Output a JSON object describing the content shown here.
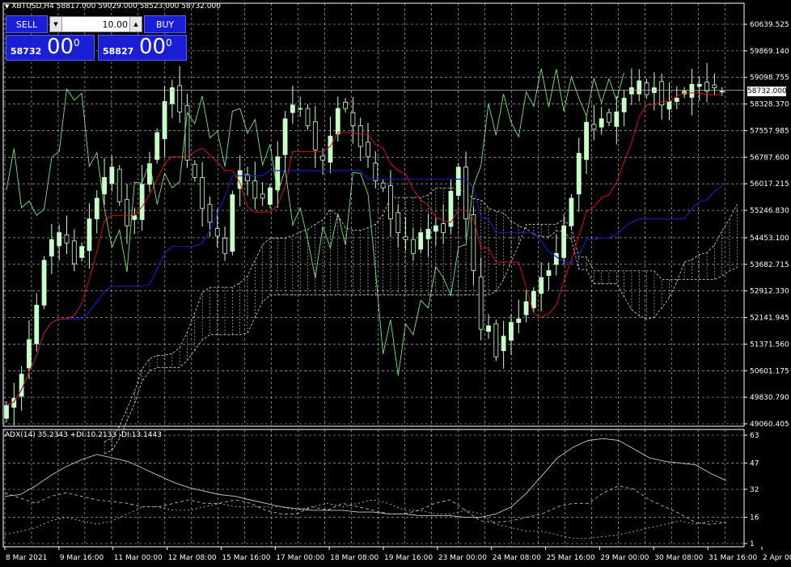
{
  "header": {
    "symbol_line": "XBTUSD,H4  58817.000 59029.000 58523.000 58732.000"
  },
  "trade_panel": {
    "sell_label": "SELL",
    "buy_label": "BUY",
    "lot": "10.00",
    "sell_price_small": "58732",
    "sell_price_big": "00",
    "sell_price_sup": "0",
    "buy_price_small": "58827",
    "buy_price_big": "00",
    "buy_price_sup": "0"
  },
  "indicator_label": "ADX(14) 35.2343 +DI:10.2133 -DI:13.1443",
  "current_price_tag": "58732.000",
  "colors": {
    "background": "#000000",
    "grid": "#c8c8c8",
    "bull_candle": "#c8ffc8",
    "tenkan": "#d11414",
    "kijun": "#1a1ab4",
    "chikou": "#78e678",
    "cloud": "#d8d8d8",
    "adx": "#c8c8c8",
    "trade_button": "#1a1fd6"
  },
  "chart_data": [
    {
      "type": "candlestick",
      "symbol": "XBTUSD",
      "timeframe": "H4",
      "yticks": [
        "60639.525",
        "59869.140",
        "59098.755",
        "58328.370",
        "57557.985",
        "56787.600",
        "56017.215",
        "55246.830",
        "54453.100",
        "53682.715",
        "52912.330",
        "52141.945",
        "51371.560",
        "50601.175",
        "49830.790",
        "49060.405"
      ],
      "xticks": [
        "8 Mar 2021",
        "9 Mar 16:00",
        "11 Mar 00:00",
        "12 Mar 08:00",
        "15 Mar 16:00",
        "17 Mar 00:00",
        "18 Mar 08:00",
        "19 Mar 16:00",
        "23 Mar 00:00",
        "24 Mar 08:00",
        "25 Mar 16:00",
        "29 Mar 00:00",
        "30 Mar 08:00",
        "31 Mar 16:00",
        "2 Apr 00:00"
      ],
      "ylim": [
        49060.405,
        60639.525
      ],
      "grid": true,
      "indicators": [
        "Ichimoku (Tenkan, Kijun, Chikou, Cloud)"
      ],
      "close_path": [
        49600,
        49800,
        50500,
        51500,
        52500,
        53800,
        54400,
        54600,
        54300,
        53700,
        54200,
        55000,
        55600,
        56200,
        56500,
        55500,
        54800,
        55100,
        56000,
        56600,
        57500,
        58400,
        58800,
        58100,
        56700,
        56200,
        55300,
        54900,
        54500,
        54000,
        55700,
        56400,
        56100,
        55600,
        55600,
        55900,
        56800,
        57900,
        58300,
        58200,
        57700,
        57000,
        56700,
        57400,
        58200,
        58200,
        57700,
        57100,
        56800,
        56100,
        55900,
        55000,
        54600,
        54400,
        54000,
        54600,
        54700,
        54800,
        54600,
        55800,
        56500,
        55000,
        53500,
        51800,
        51900,
        51000,
        51600,
        52000,
        52100,
        52600,
        52900,
        53300,
        53500,
        54000,
        54800,
        55600,
        56900,
        57800,
        57600,
        57900,
        57800,
        58100,
        58500,
        58800,
        59000,
        58600,
        58800,
        58300,
        58400,
        58500,
        58700,
        58900,
        58900,
        58700,
        58800,
        58700
      ]
    },
    {
      "type": "line",
      "indicator": "ADX",
      "period": 14,
      "values_last": {
        "ADX": 35.2343,
        "+DI": 10.2133,
        "-DI": 13.1443
      },
      "yticks": [
        "63",
        "47",
        "32",
        "16",
        "1"
      ],
      "ylim": [
        1,
        63
      ],
      "grid": true,
      "series": [
        {
          "name": "ADX",
          "values": [
            28,
            29,
            34,
            40,
            45,
            49,
            52,
            50,
            48,
            44,
            40,
            36,
            33,
            31,
            29,
            28,
            26,
            24,
            22,
            21,
            20,
            20,
            20,
            19,
            19,
            18,
            18,
            17,
            17,
            17,
            16,
            16,
            18,
            22,
            30,
            40,
            50,
            56,
            60,
            61,
            60,
            55,
            50,
            48,
            47,
            46,
            41,
            37
          ]
        },
        {
          "name": "+DI",
          "values": [
            30,
            27,
            24,
            28,
            30,
            28,
            26,
            25,
            24,
            22,
            22,
            24,
            26,
            24,
            24,
            26,
            24,
            20,
            18,
            18,
            22,
            20,
            24,
            22,
            20,
            18,
            18,
            20,
            24,
            26,
            20,
            14,
            13,
            14,
            16,
            18,
            22,
            24,
            24,
            30,
            34,
            32,
            26,
            22,
            18,
            13,
            12,
            13
          ]
        },
        {
          "name": "-DI",
          "values": [
            6,
            8,
            10,
            14,
            16,
            14,
            12,
            14,
            18,
            22,
            22,
            20,
            20,
            22,
            24,
            22,
            22,
            22,
            22,
            20,
            22,
            24,
            22,
            24,
            26,
            24,
            20,
            20,
            18,
            18,
            20,
            18,
            12,
            10,
            8,
            8,
            6,
            4,
            4,
            5,
            6,
            8,
            10,
            12,
            14,
            12,
            14,
            13
          ]
        }
      ]
    }
  ]
}
